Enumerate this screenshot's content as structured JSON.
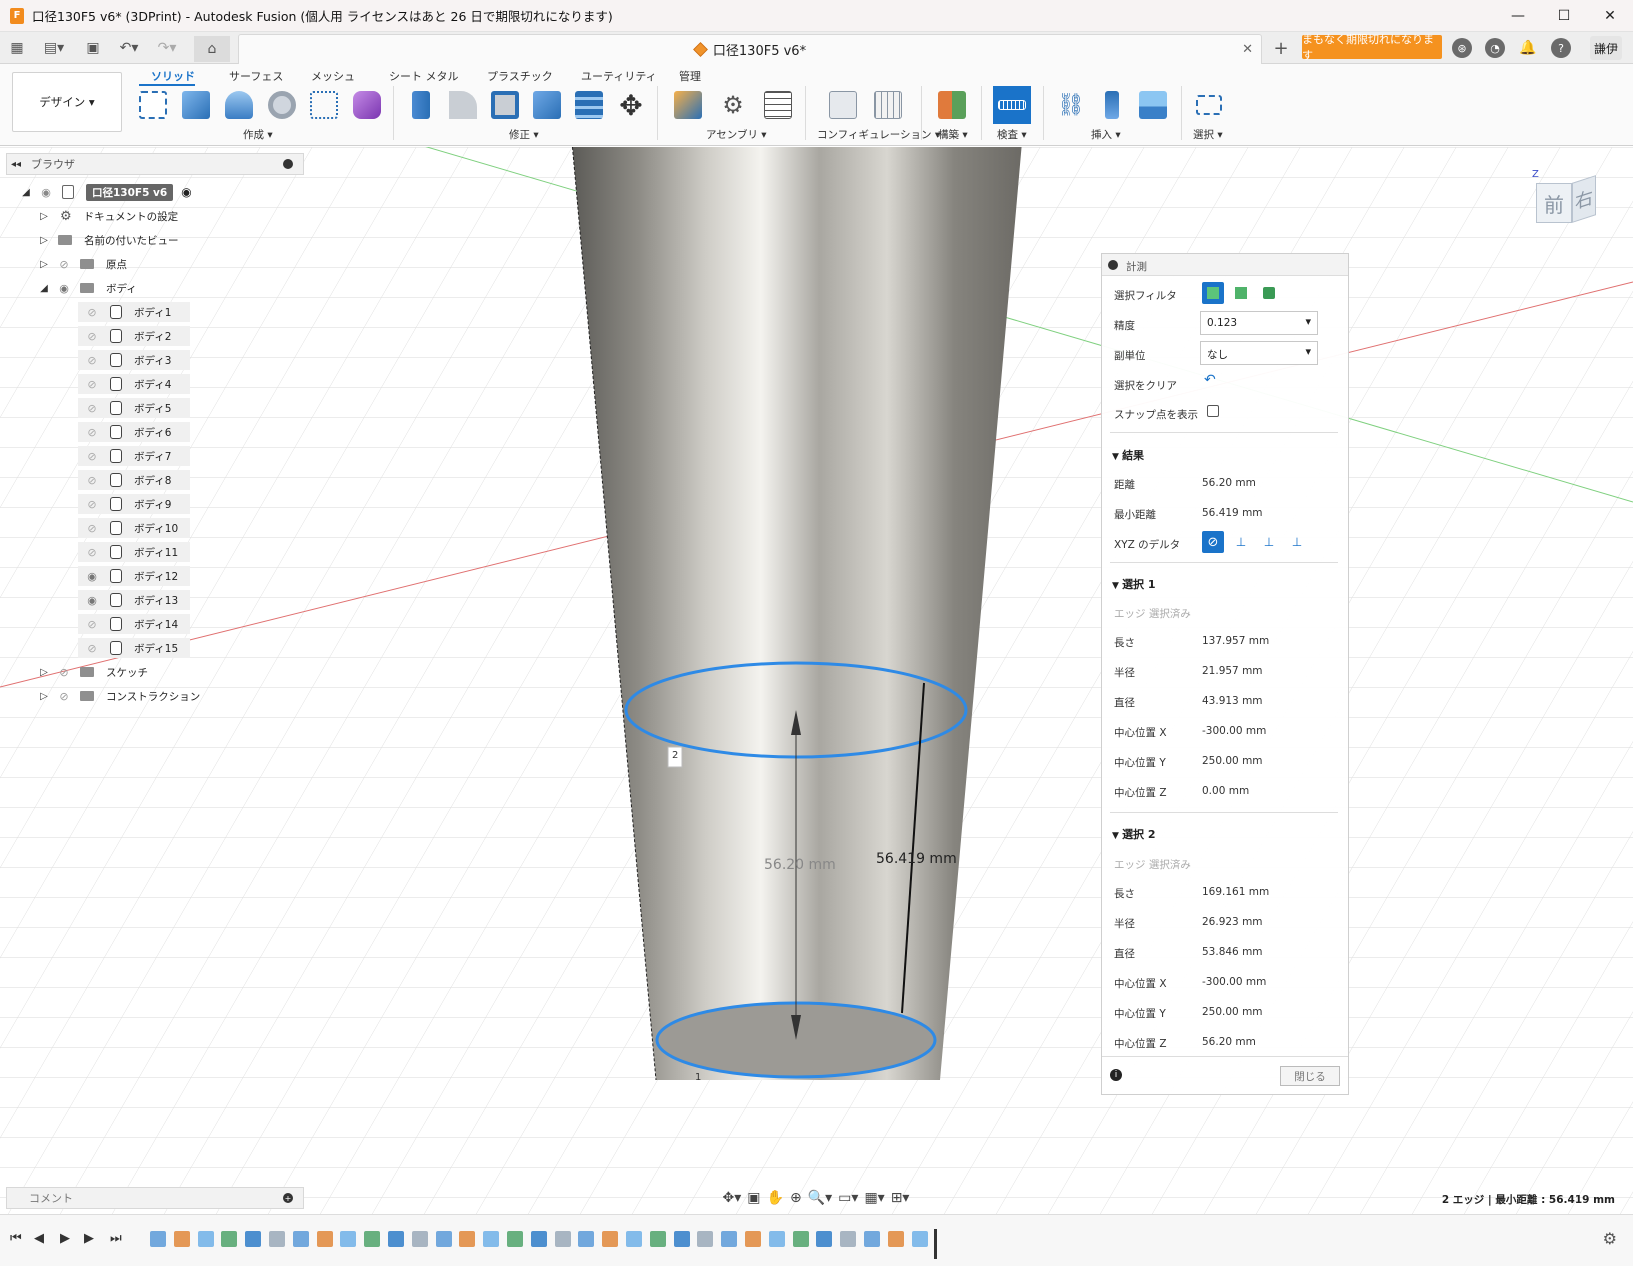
{
  "window": {
    "title": "口径130F5 v6* (3DPrint) - Autodesk Fusion (個人用 ライセンスはあと 26 日で期限切れになります)",
    "app_icon": "F",
    "controls": [
      "—",
      "☐",
      "✕"
    ]
  },
  "tabbar": {
    "doc_tab": "口径130F5 v6*",
    "expire_button": "まもなく期限切れになります",
    "user": "謙伊"
  },
  "ribbon": {
    "workspace": "デザイン ▾",
    "tabs": [
      "ソリッド",
      "サーフェス",
      "メッシュ",
      "シート メタル",
      "プラスチック",
      "ユーティリティ",
      "管理"
    ],
    "groups": [
      "作成 ▾",
      "修正 ▾",
      "アセンブリ ▾",
      "コンフィギュレーション ▾",
      "構築 ▾",
      "検査 ▾",
      "挿入 ▾",
      "選択 ▾"
    ]
  },
  "browser": {
    "title": "ブラウザ",
    "root": "口径130F5 v6",
    "items": [
      {
        "label": "ドキュメントの設定"
      },
      {
        "label": "名前の付いたビュー"
      },
      {
        "label": "原点"
      },
      {
        "label": "ボディ"
      }
    ],
    "bodies": [
      "ボディ1",
      "ボディ2",
      "ボディ3",
      "ボディ4",
      "ボディ5",
      "ボディ6",
      "ボディ7",
      "ボディ8",
      "ボディ9",
      "ボディ10",
      "ボディ11",
      "ボディ12",
      "ボディ13",
      "ボディ14",
      "ボディ15"
    ],
    "tail_items": [
      {
        "label": "スケッチ"
      },
      {
        "label": "コンストラクション"
      }
    ]
  },
  "viewcube": {
    "front": "前",
    "right": "右"
  },
  "viewport": {
    "dim_distance": "56.20 mm",
    "dim_min": "56.419 mm",
    "pt1": "1",
    "pt2": "2"
  },
  "measure": {
    "title": "計測",
    "filter_label": "選択フィルタ",
    "precision_label": "精度",
    "precision_value": "0.123",
    "subunit_label": "副単位",
    "subunit_value": "なし",
    "clear_label": "選択をクリア",
    "snap_label": "スナップ点を表示",
    "result_head": "結果",
    "distance_label": "距離",
    "distance_value": "56.20 mm",
    "min_label": "最小距離",
    "min_value": "56.419 mm",
    "xyz_label": "XYZ のデルタ",
    "sel1": {
      "head": "選択 1",
      "status": "エッジ 選択済み",
      "rows": [
        {
          "label": "長さ",
          "value": "137.957 mm"
        },
        {
          "label": "半径",
          "value": "21.957 mm"
        },
        {
          "label": "直径",
          "value": "43.913 mm"
        },
        {
          "label": "中心位置 X",
          "value": "-300.00 mm"
        },
        {
          "label": "中心位置 Y",
          "value": "250.00 mm"
        },
        {
          "label": "中心位置 Z",
          "value": "0.00 mm"
        }
      ]
    },
    "sel2": {
      "head": "選択 2",
      "status": "エッジ 選択済み",
      "rows": [
        {
          "label": "長さ",
          "value": "169.161 mm"
        },
        {
          "label": "半径",
          "value": "26.923 mm"
        },
        {
          "label": "直径",
          "value": "53.846 mm"
        },
        {
          "label": "中心位置 X",
          "value": "-300.00 mm"
        },
        {
          "label": "中心位置 Y",
          "value": "250.00 mm"
        },
        {
          "label": "中心位置 Z",
          "value": "56.20 mm"
        }
      ]
    },
    "close": "閉じる"
  },
  "bottom": {
    "comment": "コメント",
    "status": "2 エッジ | 最小距離 : 56.419 mm"
  }
}
